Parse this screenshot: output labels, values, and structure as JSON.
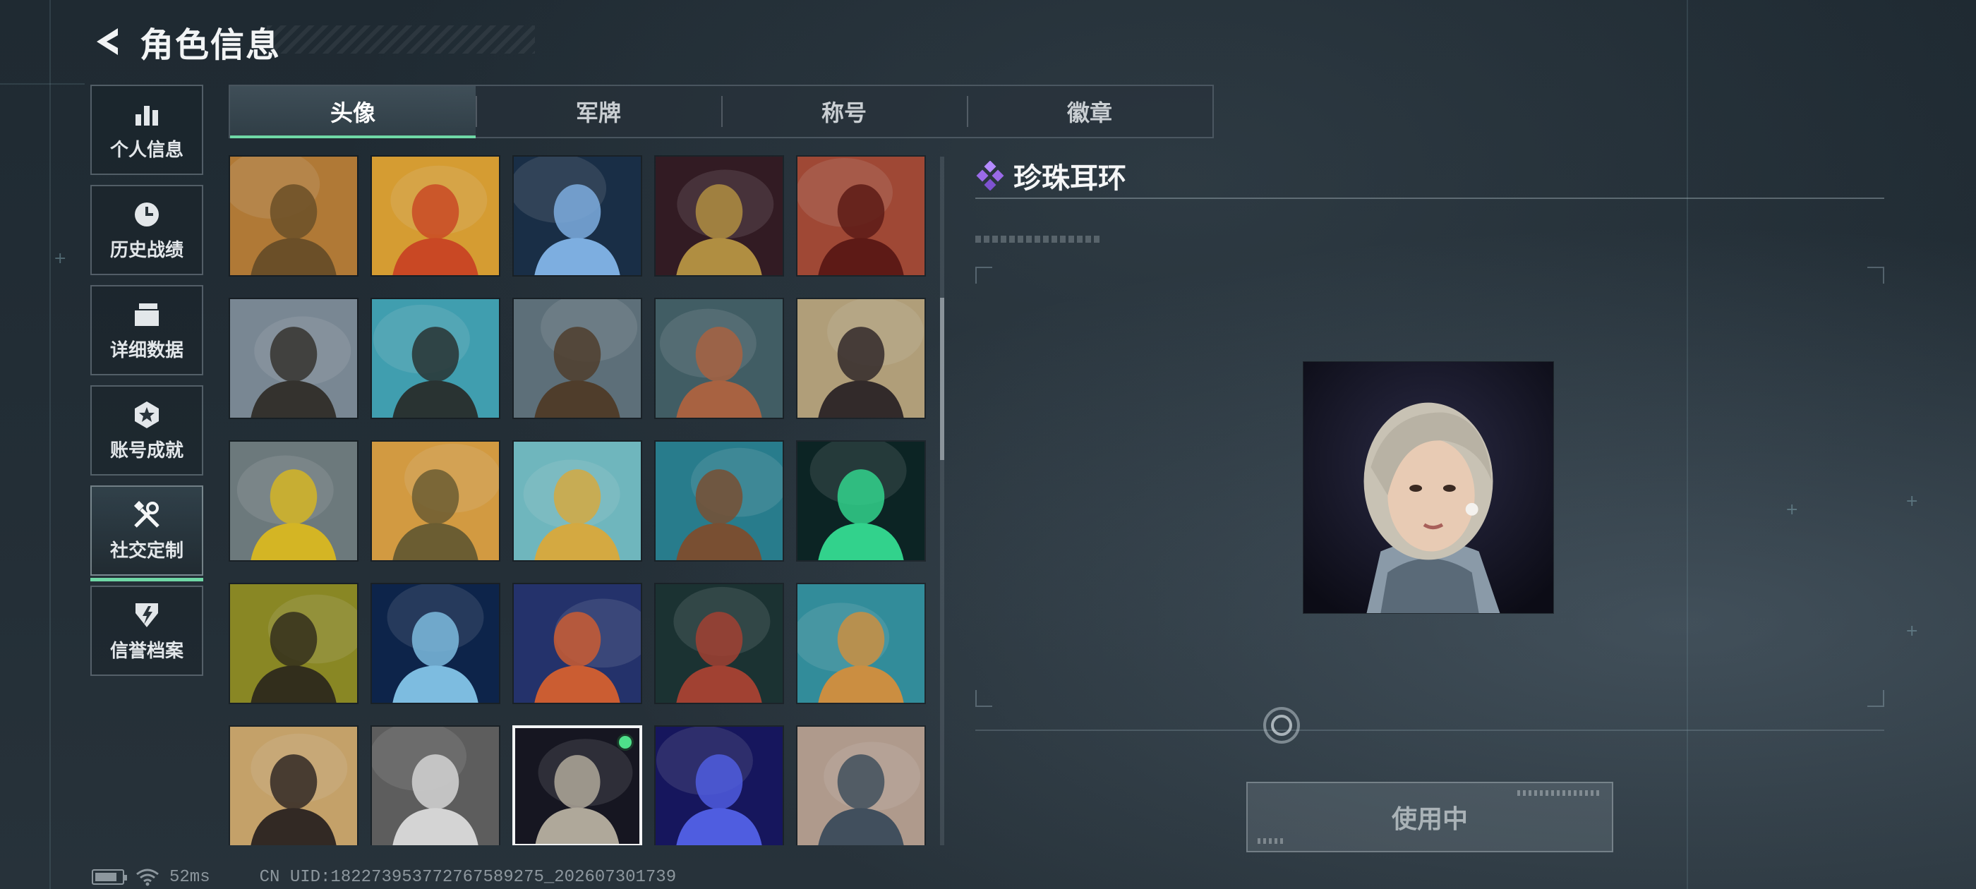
{
  "header": {
    "title": "角色信息"
  },
  "sidebar": {
    "items": [
      {
        "label": "个人信息",
        "icon": "bar-chart-icon",
        "active": false
      },
      {
        "label": "历史战绩",
        "icon": "clock-history-icon",
        "active": false
      },
      {
        "label": "详细数据",
        "icon": "folder-icon",
        "active": false
      },
      {
        "label": "账号成就",
        "icon": "star-badge-icon",
        "active": false
      },
      {
        "label": "社交定制",
        "icon": "wrench-screwdriver-icon",
        "active": true
      },
      {
        "label": "信誉档案",
        "icon": "shield-lightning-icon",
        "active": false
      }
    ]
  },
  "tabs": [
    {
      "label": "头像",
      "active": true
    },
    {
      "label": "军牌",
      "active": false
    },
    {
      "label": "称号",
      "active": false
    },
    {
      "label": "徽章",
      "active": false
    }
  ],
  "avatars": [
    {
      "icon": "bearded-man-festival-avatar",
      "bg": "#c98a3e",
      "fg": "#7a5a2e",
      "selected": false
    },
    {
      "icon": "cartoon-fries-avatar",
      "bg": "#f3b23a",
      "fg": "#e5532a",
      "selected": false
    },
    {
      "icon": "agent-lightning-avatar",
      "bg": "#1d3550",
      "fg": "#8fc6ff",
      "selected": false
    },
    {
      "icon": "treasure-chest-avatar",
      "bg": "#3a1f28",
      "fg": "#c9a24a",
      "selected": false
    },
    {
      "icon": "red-hair-woman-avatar",
      "bg": "#b5523d",
      "fg": "#6a1e1a",
      "selected": false
    },
    {
      "icon": "soldier-mountain-avatar",
      "bg": "#8a9aa8",
      "fg": "#3c3a35",
      "selected": false
    },
    {
      "icon": "beach-headphones-avatar",
      "bg": "#49b4c8",
      "fg": "#2f3b3a",
      "selected": false
    },
    {
      "icon": "thumbs-up-soldier-avatar",
      "bg": "#6a7f8a",
      "fg": "#5a4632",
      "selected": false
    },
    {
      "icon": "archer-woman-avatar",
      "bg": "#4a6a72",
      "fg": "#c0704a",
      "selected": false
    },
    {
      "icon": "goggles-girl-avatar",
      "bg": "#c9b48a",
      "fg": "#3a3030",
      "selected": false
    },
    {
      "icon": "alligator-sign-avatar",
      "bg": "#7c8a8e",
      "fg": "#f2cf2a",
      "selected": false
    },
    {
      "icon": "cartoon-dog-soldier-avatar",
      "bg": "#f0b04a",
      "fg": "#7a6a3a",
      "selected": false
    },
    {
      "icon": "cartoon-shiba-cap-avatar",
      "bg": "#7fd0d8",
      "fg": "#f2c14a",
      "selected": false
    },
    {
      "icon": "rowboat-avatar",
      "bg": "#2e8ea0",
      "fg": "#8a5a3a",
      "selected": false
    },
    {
      "icon": "neon-logo-avatar",
      "bg": "#0e2a2a",
      "fg": "#3af0a0",
      "selected": false
    },
    {
      "icon": "glasses-man-olive-avatar",
      "bg": "#9c9a2a",
      "fg": "#3a3520",
      "selected": false
    },
    {
      "icon": "neural-lightning-avatar",
      "bg": "#0f2a55",
      "fg": "#8fd6ff",
      "selected": false
    },
    {
      "icon": "cartoon-deer-gifts-avatar",
      "bg": "#2a3a7a",
      "fg": "#e86a3a",
      "selected": false
    },
    {
      "icon": "zombie-pirate-avatar",
      "bg": "#1f3a3a",
      "fg": "#b84a3a",
      "selected": false
    },
    {
      "icon": "monkey-reading-avatar",
      "bg": "#3aa0b0",
      "fg": "#e8a24a",
      "selected": false
    },
    {
      "icon": "pyramid-selfie-avatar",
      "bg": "#e0b878",
      "fg": "#3a2f2a",
      "selected": false
    },
    {
      "icon": "white-eagle-emblem-avatar",
      "bg": "#6a6a6a",
      "fg": "#f2f2f2",
      "selected": false
    },
    {
      "icon": "pearl-earring-woman-avatar",
      "bg": "#1a1a26",
      "fg": "#c8c0b0",
      "selected": true
    },
    {
      "icon": "blue-night-vision-avatar",
      "bg": "#1a1a6a",
      "fg": "#5a6aff",
      "selected": false
    },
    {
      "icon": "two-girls-anime-avatar",
      "bg": "#c8b0a0",
      "fg": "#4a5a6a",
      "selected": false
    }
  ],
  "detail": {
    "name": "珍珠耳环",
    "name_icon": "purple-diamond-rarity-icon",
    "preview_icon": "pearl-earring-woman-portrait",
    "use_button": "使用中"
  },
  "status": {
    "ping": "52ms",
    "uid": "CN UID:182273953772767589275_202607301739"
  }
}
